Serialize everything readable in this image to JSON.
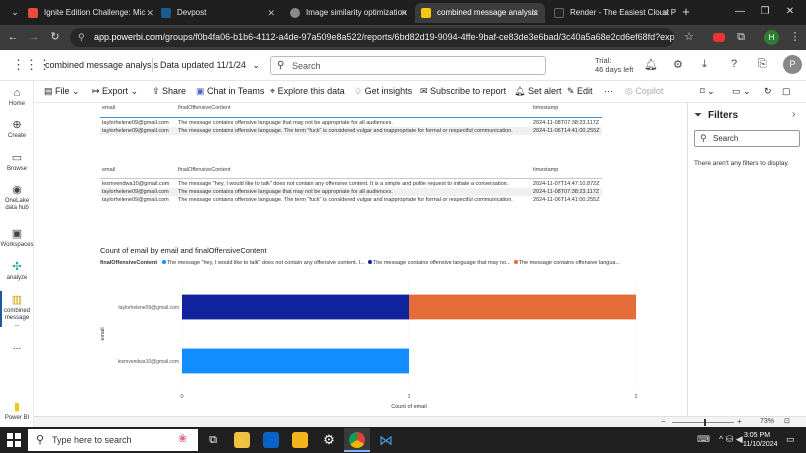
{
  "browser": {
    "tabs": [
      {
        "title": "Ignite Edition Challenge: Mic",
        "color": "#e74c3c",
        "active": false
      },
      {
        "title": "Devpost",
        "color": "#1d5c8f",
        "active": false
      },
      {
        "title": "Image similarity optimization",
        "color": "#8a8a8a",
        "active": false
      },
      {
        "title": "combined message analysis",
        "color": "#f2c811",
        "active": true
      },
      {
        "title": "Render - The Easiest Cloud P",
        "color": "#222222",
        "active": false
      }
    ],
    "new_tab": "+",
    "url_host": "app.powerbi.com",
    "url_path": "/groups/f0b4fa06-b1b6-4112-a4de-97a509e8a522/reports/6bd82d19-9094-4ffe-9baf-ce83de3e6bad/3c40a5a68e2cd6ef68fd?experience=po...",
    "profile_initial": "H"
  },
  "app_header": {
    "report_name": "combined message analysis",
    "data_updated": "Data updated 11/1/24",
    "search_placeholder": "Search",
    "trial_line1": "Trial:",
    "trial_line2": "46 days left",
    "avatar_initial": "P"
  },
  "ribbon": {
    "file": "File",
    "export": "Export",
    "share": "Share",
    "chat": "Chat in Teams",
    "explore": "Explore this data",
    "insights": "Get insights",
    "subscribe": "Subscribe to report",
    "alert": "Set alert",
    "edit": "Edit",
    "more": "···",
    "copilot": "Copilot"
  },
  "rail": [
    {
      "label": "Home",
      "icon": "home-icon"
    },
    {
      "label": "Create",
      "icon": "plus-circle-icon"
    },
    {
      "label": "Browse",
      "icon": "folder-icon"
    },
    {
      "label": "OneLake data hub",
      "icon": "onelake-icon"
    },
    {
      "label": "Workspaces",
      "icon": "workspaces-icon"
    },
    {
      "label": "analyze",
      "icon": "analyze-icon"
    },
    {
      "label": "combined message ...",
      "icon": "report-icon"
    },
    {
      "label": "...",
      "icon": "more-icon"
    },
    {
      "label": "Power BI",
      "icon": "powerbi-logo"
    }
  ],
  "table1": {
    "headers": [
      "email",
      "finalOffensiveContent",
      "timestamp"
    ],
    "rows": [
      [
        "taylorhelene09@gmail.com",
        "The message contains offensive language that may not be appropriate for all audiences.",
        "2024-11-08T07:38:23.117Z"
      ],
      [
        "taylorhelene09@gmail.com",
        "The message contains offensive language. The term \"fuck\" is considered vulgar and inappropriate for formal or respectful communication.",
        "2024-11-06T14:41:00.255Z"
      ]
    ]
  },
  "table2": {
    "headers": [
      "email",
      "finalOffensiveContent",
      "timestamp"
    ],
    "rows": [
      [
        "lesmvendwa10@gmail.com",
        "The message \"hey, I would like to talk\" does not contain any offensive content. It is a simple and polite request to initiate a conversation.",
        "2024-11-07T14:47:10.872Z"
      ],
      [
        "taylorhelene09@gmail.com",
        "The message contains offensive language that may not be appropriate for all audiences.",
        "2024-11-08T07:38:23.117Z"
      ],
      [
        "taylorhelene09@gmail.com",
        "The message contains offensive language. The term \"fuck\" is considered vulgar and inappropriate for formal or respectful communication.",
        "2024-11-06T14:41:00.255Z"
      ]
    ]
  },
  "chart_data": {
    "type": "bar",
    "orientation": "horizontal",
    "stacked": true,
    "title": "Count of email by email and finalOffensiveContent",
    "legend_title": "finalOffensiveContent",
    "legend_placement": "top-left",
    "xlabel": "Count of email",
    "ylabel": "email",
    "xlim": [
      0,
      2
    ],
    "x_ticks": [
      "0",
      "1",
      "2"
    ],
    "grid": true,
    "categories": [
      "taylorhelene09@gmail.com",
      "lesmvendwa10@gmail.com"
    ],
    "series": [
      {
        "name": "The message \"hey, I would like to talk\" does not contain any offensive content. I...",
        "color": "#118dff",
        "values": [
          0,
          1
        ]
      },
      {
        "name": "The message contains offensive language that may no...",
        "color": "#12239e",
        "values": [
          1,
          0
        ]
      },
      {
        "name": "The message contains offensive langua...",
        "color": "#e66c37",
        "values": [
          1,
          0
        ]
      }
    ]
  },
  "filters": {
    "title": "Filters",
    "search_placeholder": "Search",
    "empty_text": "There aren't any filters to display."
  },
  "statusbar": {
    "zoom": "73%"
  },
  "taskbar": {
    "search_placeholder": "Type here to search",
    "time": "3:05 PM",
    "date": "11/10/2024"
  }
}
